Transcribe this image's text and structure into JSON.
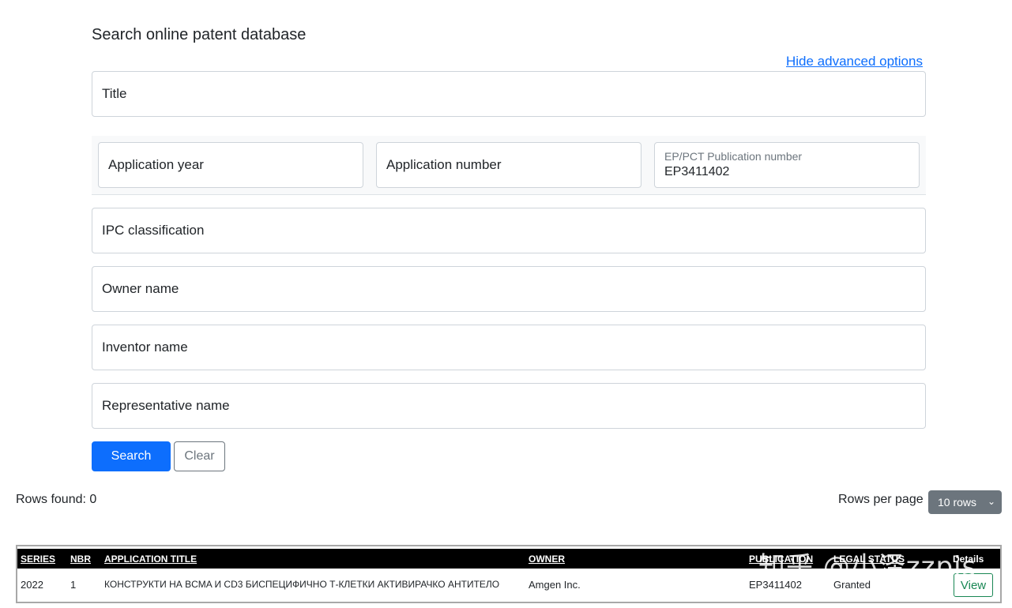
{
  "page": {
    "heading": "Search online patent database",
    "toggle_advanced": "Hide advanced options"
  },
  "form": {
    "title_label": "Title",
    "application_year_label": "Application year",
    "application_number_label": "Application number",
    "publication_number_label": "EP/PCT Publication number",
    "publication_number_value": "EP3411402",
    "ipc_label": "IPC classification",
    "owner_label": "Owner name",
    "inventor_label": "Inventor name",
    "representative_label": "Representative name",
    "search_button": "Search",
    "clear_button": "Clear"
  },
  "results": {
    "rows_found": "Rows found: 0",
    "rows_per_page_label": "Rows per page",
    "rows_per_page_value": "10 rows",
    "columns": {
      "series": "SERIES",
      "nbr": "NBR",
      "title": "APPLICATION TITLE",
      "owner": "OWNER",
      "publication": "PUBLICATION",
      "status": "LEGAL STATUS",
      "details": "Details"
    },
    "rows": [
      {
        "series": "2022",
        "nbr": "1",
        "title": "КОНСТРУКТИ НА BCMA И CD3 БИСПЕЦИФИЧНО Т-КЛЕТКИ АКТИВИРАЧКО АНТИТЕЛО",
        "owner": "Amgen Inc.",
        "publication": "EP3411402",
        "status": "Granted",
        "action": "View"
      }
    ]
  },
  "watermark": "知乎 @小泽zzpis",
  "colors": {
    "primary": "#0d6efd",
    "secondary": "#6c757d",
    "success": "#198754",
    "table_header": "#000000"
  }
}
